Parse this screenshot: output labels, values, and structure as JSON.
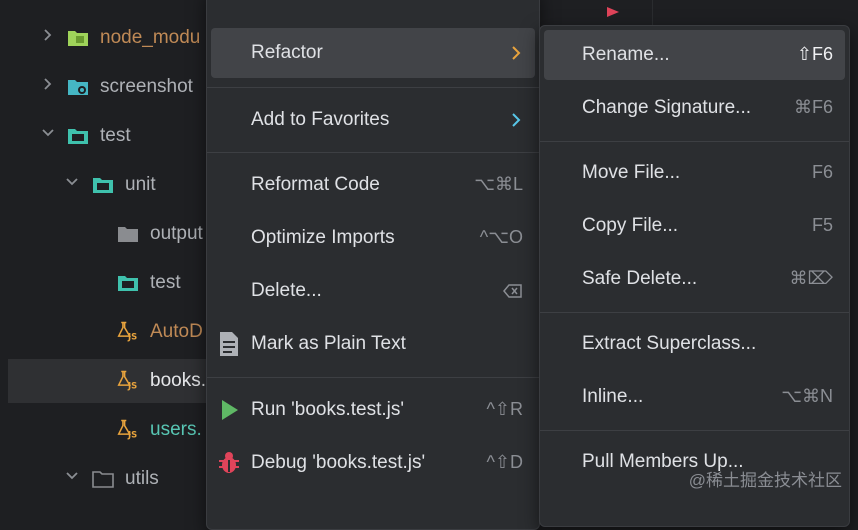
{
  "tree": {
    "items": [
      {
        "label": "node_modu",
        "icon": "module-folder-icon"
      },
      {
        "label": "screenshot",
        "icon": "image-folder-icon"
      },
      {
        "label": "test",
        "icon": "test-folder-icon"
      },
      {
        "label": "unit",
        "icon": "test-folder-icon"
      },
      {
        "label": "output",
        "icon": "folder-icon"
      },
      {
        "label": "test",
        "icon": "test-folder-icon"
      },
      {
        "label": "AutoD",
        "icon": "js-test-file-icon"
      },
      {
        "label": "books.",
        "icon": "js-test-file-icon"
      },
      {
        "label": "users.",
        "icon": "js-test-file-icon"
      },
      {
        "label": "utils",
        "icon": "folder-icon"
      }
    ]
  },
  "context_menu": {
    "refactor": "Refactor",
    "add_to_favorites": "Add to Favorites",
    "reformat_code": "Reformat Code",
    "reformat_code_shortcut": "⌥⌘L",
    "optimize_imports": "Optimize Imports",
    "optimize_imports_shortcut": "^⌥O",
    "delete": "Delete...",
    "mark_as_plain_text": "Mark as Plain Text",
    "run": "Run 'books.test.js'",
    "run_shortcut": "^⇧R",
    "debug": "Debug 'books.test.js'",
    "debug_shortcut": "^⇧D"
  },
  "refactor_submenu": {
    "rename": "Rename...",
    "rename_shortcut": "⇧F6",
    "change_signature": "Change Signature...",
    "change_signature_shortcut": "⌘F6",
    "move_file": "Move File...",
    "move_file_shortcut": "F6",
    "copy_file": "Copy File...",
    "copy_file_shortcut": "F5",
    "safe_delete": "Safe Delete...",
    "safe_delete_shortcut": "⌘⌦",
    "extract_superclass": "Extract Superclass...",
    "inline": "Inline...",
    "inline_shortcut": "⌥⌘N",
    "pull_members_up": "Pull Members Up..."
  },
  "watermark": "@稀土掘金技术社区",
  "colors": {
    "background": "#1e1f22",
    "menu_background": "#2b2d30",
    "highlight": "#424448",
    "accent_orange": "#e8a33d",
    "accent_teal": "#3fc1ad",
    "run_green": "#5fb865",
    "debug_red": "#e0445a"
  }
}
